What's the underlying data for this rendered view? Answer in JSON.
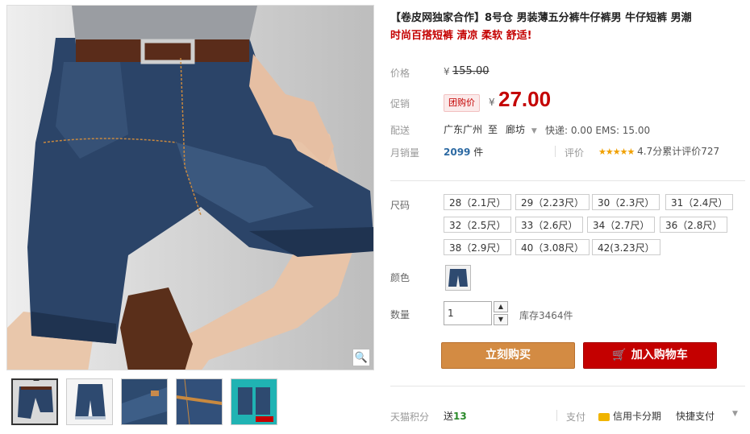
{
  "product": {
    "title_line1": "【卷皮网独家合作】8号仓 男装薄五分裤牛仔裤男 牛仔短裤 男潮",
    "title_line2": "时尚百搭短裤 清凉 柔软 舒适!"
  },
  "price": {
    "label": "价格",
    "currency": "¥",
    "original": "155.00"
  },
  "promo": {
    "label": "促销",
    "tag": "团购价",
    "currency": "¥",
    "price": "27.00"
  },
  "shipping": {
    "label": "配送",
    "from": "广东广州",
    "to_word": "至",
    "to": "廊坊",
    "fees": "快递: 0.00  EMS: 15.00"
  },
  "sales": {
    "label": "月销量",
    "count": "2099",
    "unit": "件",
    "review_label": "评价",
    "stars": "★★★★★",
    "rating_text": "4.7分",
    "review_count_text": "累计评价727"
  },
  "size": {
    "label": "尺码",
    "options": [
      "28（2.1尺）",
      "29（2.23尺）",
      "30（2.3尺）",
      "31（2.4尺）",
      "32（2.5尺）",
      "33（2.6尺）",
      "34（2.7尺）",
      "36（2.8尺）",
      "38（2.9尺）",
      "40（3.08尺）",
      "42(3.23尺）"
    ]
  },
  "color": {
    "label": "颜色"
  },
  "quantity": {
    "label": "数量",
    "value": "1",
    "stock": "库存3464件"
  },
  "buttons": {
    "buy_now": "立刻购买",
    "add_to_cart": "加入购物车"
  },
  "footer": {
    "points_label": "天猫积分",
    "points_text_prefix": "送",
    "points_value": "13",
    "pay_label": "支付",
    "installment": "信用卡分期",
    "quick_pay": "快捷支付"
  },
  "colors": {
    "accent_red": "#c40000",
    "buy_orange": "#d38b43"
  }
}
